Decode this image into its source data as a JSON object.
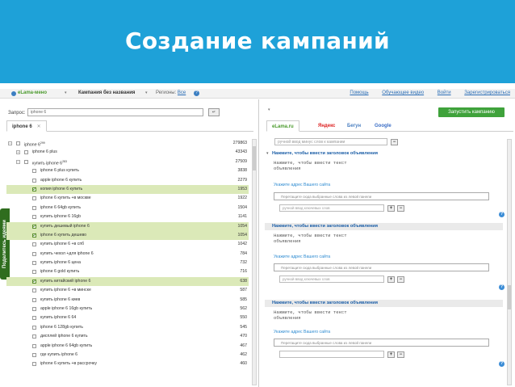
{
  "banner": {
    "title": "Создание кампаний"
  },
  "topbar": {
    "logo": "eLama-мено",
    "campaign": "Кампания без названия",
    "regions_label": "Регионы:",
    "regions_value": "Все",
    "help_glyph": "?",
    "links": [
      "Помощь",
      "Обучающее видео",
      "Войти",
      "Зарегистрироваться"
    ]
  },
  "left": {
    "side_tab": "Поделитесь идеями",
    "query_label": "Запрос:",
    "query_value": "iphone 6",
    "query_button": "↵",
    "tab_label": "iphone 6",
    "tab_close": "✕",
    "keywords": [
      {
        "text": "iphone 6",
        "sup": "299",
        "count": "279863",
        "toggle": "−",
        "checked": false,
        "hl": false,
        "level": 0
      },
      {
        "text": "iphone 6 plus",
        "sup": "",
        "count": "43343",
        "toggle": "+",
        "checked": false,
        "hl": false,
        "level": 1
      },
      {
        "text": "купить iphone 6",
        "sup": "283",
        "count": "27509",
        "toggle": "−",
        "checked": false,
        "hl": false,
        "level": 1
      },
      {
        "text": "iphone 6 plus купить",
        "sup": "",
        "count": "3838",
        "toggle": "",
        "checked": false,
        "hl": false,
        "level": 2
      },
      {
        "text": "apple iphone 6 купить",
        "sup": "",
        "count": "2279",
        "toggle": "",
        "checked": false,
        "hl": false,
        "level": 2
      },
      {
        "text": "копия iphone 6 купить",
        "sup": "",
        "count": "1953",
        "toggle": "",
        "checked": true,
        "hl": true,
        "level": 2
      },
      {
        "text": "iphone 6 купить +в москве",
        "sup": "",
        "count": "1922",
        "toggle": "",
        "checked": false,
        "hl": false,
        "level": 2
      },
      {
        "text": "iphone 6 64gb купить",
        "sup": "",
        "count": "1504",
        "toggle": "",
        "checked": false,
        "hl": false,
        "level": 2
      },
      {
        "text": "купить iphone 6 16gb",
        "sup": "",
        "count": "1141",
        "toggle": "",
        "checked": false,
        "hl": false,
        "level": 2
      },
      {
        "text": "купить дешевый iphone 6",
        "sup": "",
        "count": "1054",
        "toggle": "",
        "checked": true,
        "hl": true,
        "level": 2
      },
      {
        "text": "iphone 6 купить дешево",
        "sup": "",
        "count": "1054",
        "toggle": "",
        "checked": true,
        "hl": true,
        "level": 2
      },
      {
        "text": "купить iphone 6 +в спб",
        "sup": "",
        "count": "1042",
        "toggle": "",
        "checked": false,
        "hl": false,
        "level": 2
      },
      {
        "text": "купить чехол +для iphone 6",
        "sup": "",
        "count": "784",
        "toggle": "",
        "checked": false,
        "hl": false,
        "level": 2
      },
      {
        "text": "купить iphone 6 цена",
        "sup": "",
        "count": "732",
        "toggle": "",
        "checked": false,
        "hl": false,
        "level": 2
      },
      {
        "text": "iphone 6 gold купить",
        "sup": "",
        "count": "716",
        "toggle": "",
        "checked": false,
        "hl": false,
        "level": 2
      },
      {
        "text": "купить китайский iphone 6",
        "sup": "",
        "count": "638",
        "toggle": "",
        "checked": true,
        "hl": true,
        "level": 2
      },
      {
        "text": "купить iphone 6 +в минске",
        "sup": "",
        "count": "587",
        "toggle": "",
        "checked": false,
        "hl": false,
        "level": 2
      },
      {
        "text": "купить iphone 6 киев",
        "sup": "",
        "count": "585",
        "toggle": "",
        "checked": false,
        "hl": false,
        "level": 2
      },
      {
        "text": "apple iphone 6 16gb купить",
        "sup": "",
        "count": "562",
        "toggle": "",
        "checked": false,
        "hl": false,
        "level": 2
      },
      {
        "text": "купить iphone 6 64",
        "sup": "",
        "count": "550",
        "toggle": "",
        "checked": false,
        "hl": false,
        "level": 2
      },
      {
        "text": "iphone 6 128gb купить",
        "sup": "",
        "count": "545",
        "toggle": "",
        "checked": false,
        "hl": false,
        "level": 2
      },
      {
        "text": "дисплей iphone 6 купить",
        "sup": "",
        "count": "470",
        "toggle": "",
        "checked": false,
        "hl": false,
        "level": 2
      },
      {
        "text": "apple iphone 6 64gb купить",
        "sup": "",
        "count": "467",
        "toggle": "",
        "checked": false,
        "hl": false,
        "level": 2
      },
      {
        "text": "где купить iphone 6",
        "sup": "",
        "count": "462",
        "toggle": "",
        "checked": false,
        "hl": false,
        "level": 2
      },
      {
        "text": "iphone 6 купить +в рассрочку",
        "sup": "",
        "count": "460",
        "toggle": "",
        "checked": false,
        "hl": false,
        "level": 2
      }
    ]
  },
  "right": {
    "run_button": "Запустить кампанию",
    "tabs": [
      "eLama.ru",
      "Яндекс",
      "Бегун",
      "Google"
    ],
    "minus_placeholder": "ручной ввод минус слов к кампании",
    "ads": [
      {
        "title": "Нажмите, чтобы ввести заголовок объявления",
        "desc": "Нажмите, чтобы ввести текст объявления",
        "addr": "Укажите адрес Вашего сайта",
        "link": "Перетащите сюда выбранные слова из левой панели",
        "kw": "ручной ввод ключевых слов",
        "help": "?"
      },
      {
        "title": "Нажмите, чтобы ввести заголовок объявления",
        "desc": "Нажмите, чтобы ввести текст объявления",
        "addr": "Укажите адрес Вашего сайта",
        "link": "Перетащите сюда выбранные слова из левой панели",
        "kw": "ручной ввод ключевых слов",
        "help": "?"
      },
      {
        "title": "Нажмите, чтобы ввести заголовок объявления",
        "desc": "Нажмите, чтобы ввести текст объявления",
        "addr": "Укажите адрес Вашего сайта",
        "link": "Перетащите сюда выбранные слова из левой панели",
        "kw": "",
        "help": "?"
      }
    ]
  },
  "colors": {
    "banner": "#1ea1d8",
    "highlight": "#dbe9b8",
    "run_button": "#3fa23b",
    "link": "#1a5da6",
    "side_tab": "#2f6d1e"
  }
}
